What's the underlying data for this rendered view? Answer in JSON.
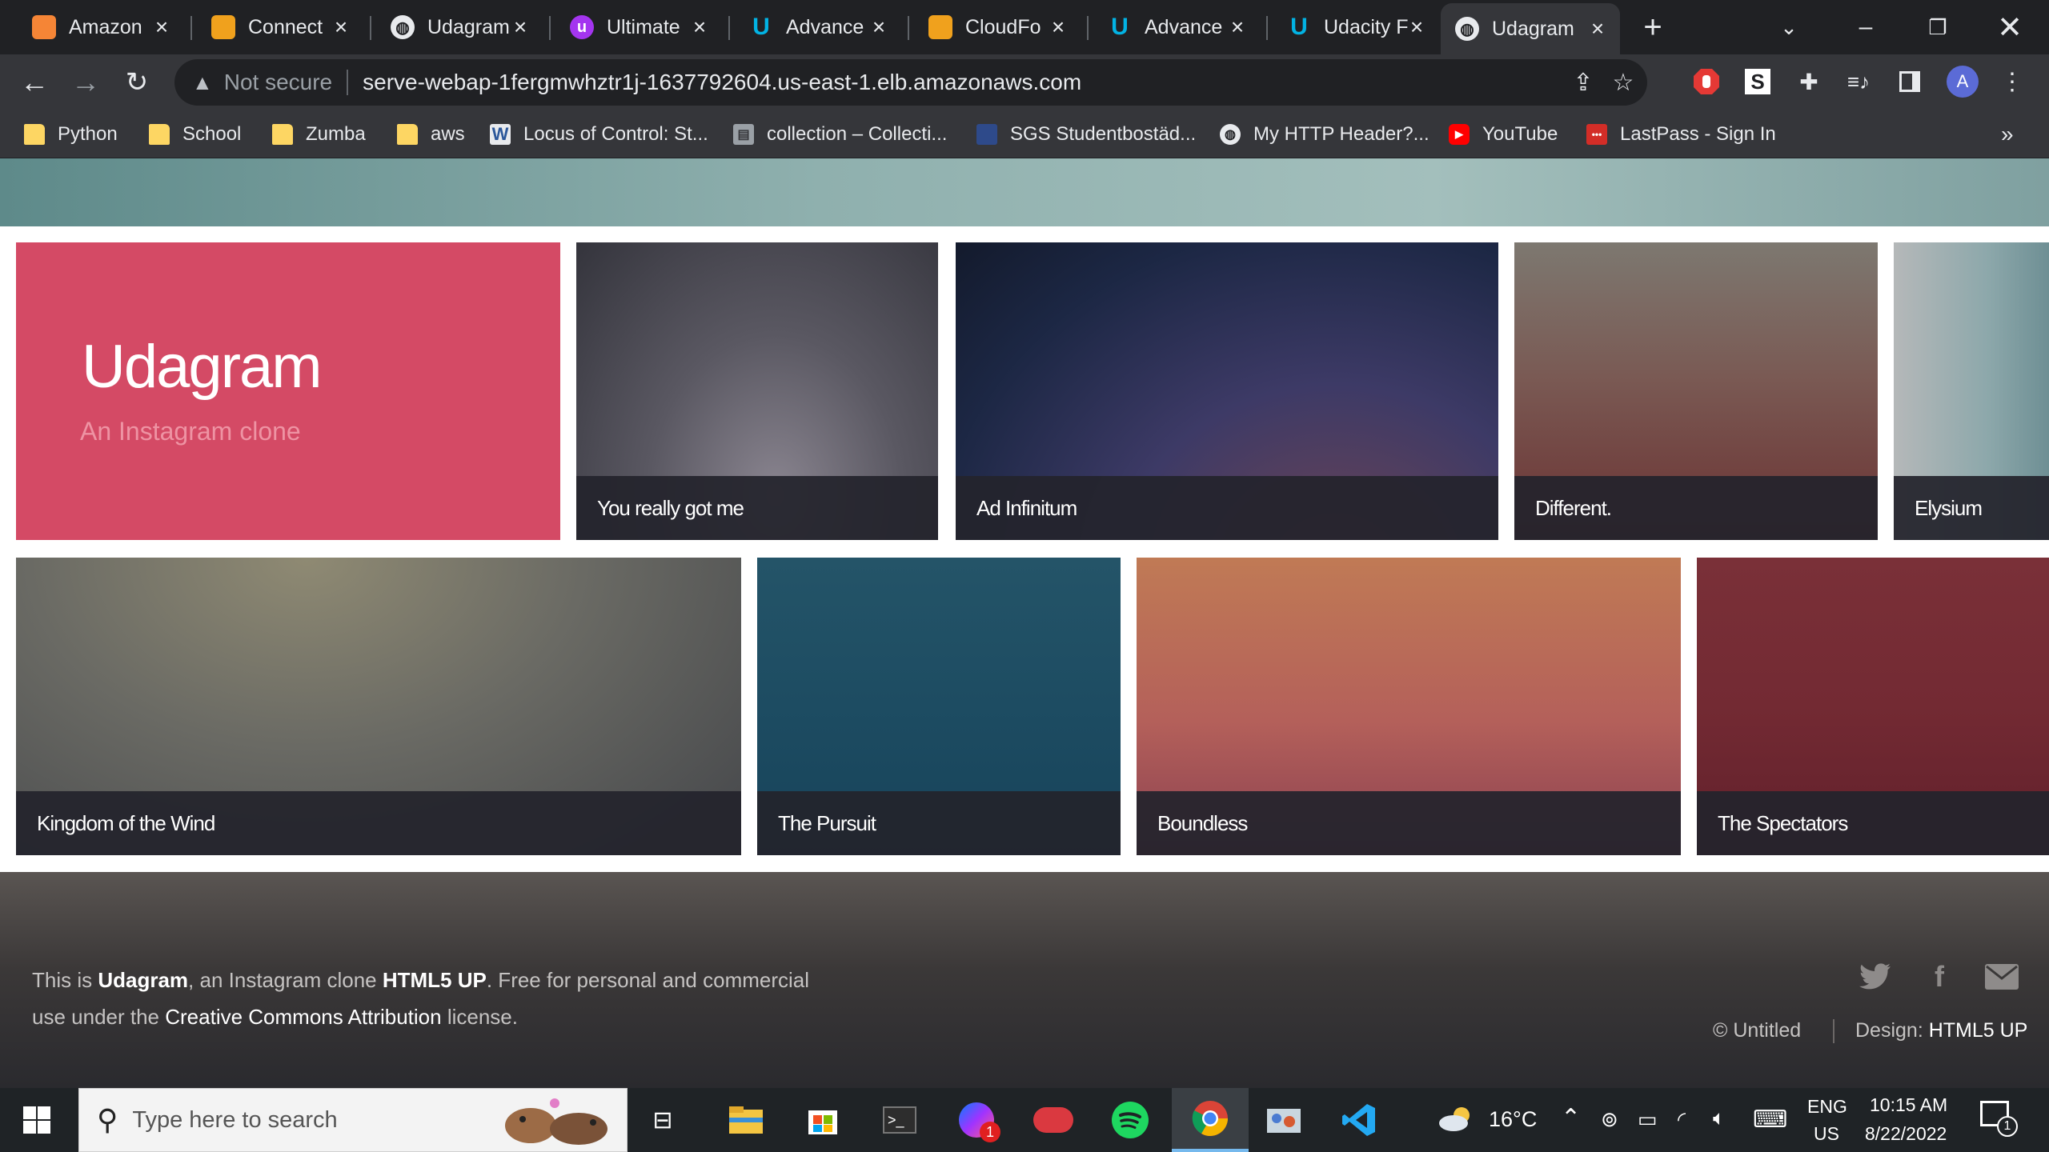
{
  "browser": {
    "tabs": [
      {
        "title": "Amazon",
        "icon": "amazon-box-icon",
        "color": "#f58536"
      },
      {
        "title": "Connect",
        "icon": "package-icon",
        "color": "#f0a11d"
      },
      {
        "title": "Udagram",
        "icon": "globe-icon",
        "color": "#e8eaed"
      },
      {
        "title": "Ultimate",
        "icon": "udemy-icon",
        "color": "#a435f0"
      },
      {
        "title": "Advance",
        "icon": "udacity-icon",
        "color": "#02b3e4"
      },
      {
        "title": "CloudFo",
        "icon": "package-icon",
        "color": "#f0a11d"
      },
      {
        "title": "Advance",
        "icon": "udacity-icon",
        "color": "#02b3e4"
      },
      {
        "title": "Udacity F",
        "icon": "udacity-icon",
        "color": "#02b3e4"
      },
      {
        "title": "Udagram",
        "icon": "globe-icon",
        "color": "#e8eaed"
      }
    ],
    "active_tab_index": 8,
    "address": {
      "security_label": "Not secure",
      "url": "serve-webap-1fergmwhztr1j-1637792604.us-east-1.elb.amazonaws.com"
    },
    "profile_initial": "A",
    "bookmarks": [
      {
        "label": "Python",
        "icon": "folder-icon"
      },
      {
        "label": "School",
        "icon": "folder-icon"
      },
      {
        "label": "Zumba",
        "icon": "folder-icon"
      },
      {
        "label": "aws",
        "icon": "folder-icon"
      },
      {
        "label": "Locus of Control: St...",
        "icon": "word-icon"
      },
      {
        "label": "collection – Collecti...",
        "icon": "collection-icon"
      },
      {
        "label": "SGS Studentbostäd...",
        "icon": "sgs-icon"
      },
      {
        "label": "My HTTP Header?...",
        "icon": "globe-icon"
      },
      {
        "label": "YouTube",
        "icon": "youtube-icon"
      },
      {
        "label": "LastPass - Sign In",
        "icon": "lastpass-icon"
      }
    ],
    "bookmarks_overflow": "»"
  },
  "site": {
    "title": "Udagram",
    "subtitle": "An Instagram clone",
    "accent_color": "#d44a65",
    "tiles_row1": [
      "You really got me",
      "Ad Infinitum",
      "Different.",
      "Elysium"
    ],
    "tiles_row2": [
      "Kingdom of the Wind",
      "The Pursuit",
      "Boundless",
      "The Spectators"
    ],
    "footer": {
      "line1_prefix": "This is ",
      "line1_brand": "Udagram",
      "line1_mid": ", an Instagram clone ",
      "line1_link": "HTML5 UP",
      "line1_suffix": ". Free for personal and commercial",
      "line2_prefix": "use under the ",
      "line2_link": "Creative Commons Attribution",
      "line2_suffix": " license.",
      "copyright": "© Untitled",
      "design_label": "Design: ",
      "design_link": "HTML5 UP",
      "social": [
        "twitter-icon",
        "facebook-icon",
        "email-icon"
      ]
    }
  },
  "taskbar": {
    "search_placeholder": "Type here to search",
    "weather": "16°C",
    "language": "ENG",
    "region": "US",
    "time": "10:15 AM",
    "date": "8/22/2022",
    "notification_count": "1",
    "messenger_badge": "1"
  }
}
